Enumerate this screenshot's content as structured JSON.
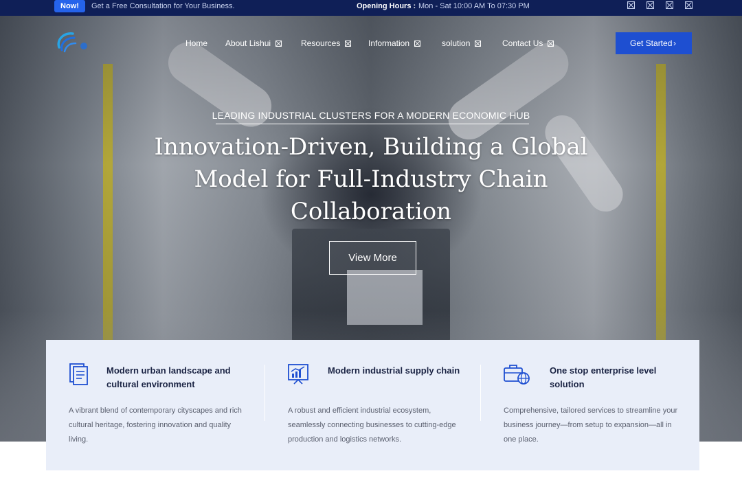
{
  "topbar": {
    "badge": "Now!",
    "promo": "Get a Free Consultation for Your Business.",
    "hours_label": "Opening Hours :",
    "hours_value": "Mon - Sat 10:00 AM To 07:30 PM",
    "social_icons": [
      "social-icon-1",
      "social-icon-2",
      "social-icon-3",
      "social-icon-4"
    ]
  },
  "nav": {
    "items": [
      {
        "label": "Home"
      },
      {
        "label": "About Lishui"
      },
      {
        "label": "Resources"
      },
      {
        "label": "Information"
      },
      {
        "label": "solution"
      },
      {
        "label": "Contact Us"
      }
    ],
    "cta_label": "Get Started",
    "cta_icon": "chevron-right-icon"
  },
  "hero": {
    "eyebrow": "LEADING INDUSTRIAL CLUSTERS FOR A MODERN ECONOMIC HUB",
    "title": "Innovation-Driven, Building a Global Model for Full-Industry Chain Collaboration",
    "button": "View More"
  },
  "features": [
    {
      "icon": "document-icon",
      "title": "Modern urban landscape and cultural environment",
      "desc": "A vibrant blend of contemporary cityscapes and rich cultural heritage, fostering innovation and quality living."
    },
    {
      "icon": "chart-board-icon",
      "title": "Modern industrial supply chain",
      "desc": "A robust and efficient industrial ecosystem, seamlessly connecting businesses to cutting-edge production and logistics networks."
    },
    {
      "icon": "briefcase-globe-icon",
      "title": "One stop enterprise level solution",
      "desc": "Comprehensive, tailored services to streamline your business journey—from setup to expansion—all in one place."
    }
  ],
  "colors": {
    "topbar_bg": "#0f1f57",
    "accent": "#1e4fd1",
    "feature_bg": "#e9eef9"
  }
}
